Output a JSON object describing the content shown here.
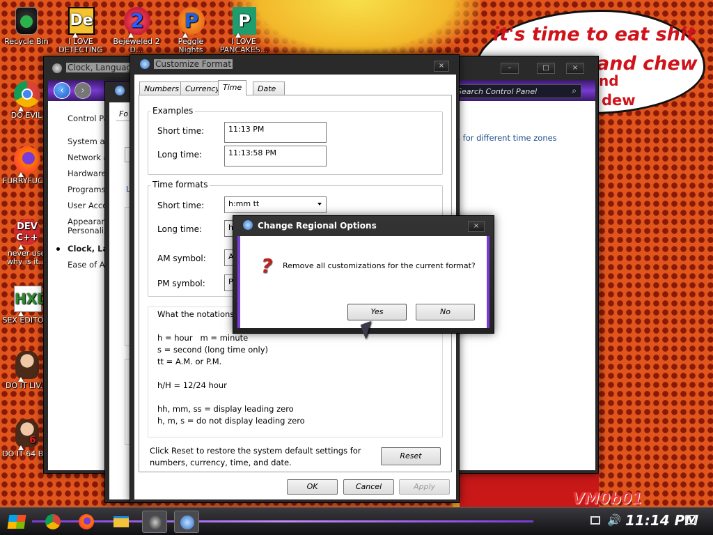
{
  "desktop": {
    "icons": [
      {
        "label": "Recycle Bin"
      },
      {
        "label": "I LOVE DETECTING"
      },
      {
        "label": "Bejeweled 2 D..."
      },
      {
        "label": "Peggle Nights"
      },
      {
        "label": "I LOVE PANCAKES..."
      },
      {
        "label": "DO EVIL"
      },
      {
        "label": "FURRYFUC..."
      },
      {
        "label": "never use why is it..."
      },
      {
        "label": "SEX EDITO..."
      },
      {
        "label": "DO IT LIV..."
      },
      {
        "label": "DO IT 64 B..."
      }
    ],
    "speech_bubble": {
      "line1": "it's time to eat shit",
      "line2": "and chew",
      "line3": "nd",
      "line4": "dew"
    },
    "watermark": "VM0b01"
  },
  "control_panel": {
    "title": "Clock, Language, and Region",
    "search_placeholder": "Search Control Panel",
    "sidebar": [
      {
        "label": "Control Pa..."
      },
      {
        "label": "System an..."
      },
      {
        "label": "Network a..."
      },
      {
        "label": "Hardware ..."
      },
      {
        "label": "Programs"
      },
      {
        "label": "User Acco..."
      },
      {
        "label": "Appearanc..."
      },
      {
        "label": "Personaliz..."
      },
      {
        "label": "Clock, Lan..."
      },
      {
        "label": "Ease of A..."
      }
    ],
    "link_text": "s for different time zones"
  },
  "region_window": {
    "tab_label": "Fo"
  },
  "customize_format": {
    "title": "Customize Format",
    "tabs": [
      "Numbers",
      "Currency",
      "Time",
      "Date"
    ],
    "active_tab": "Time",
    "examples": {
      "legend": "Examples",
      "short_label": "Short time:",
      "short_value": "11:13 PM",
      "long_label": "Long time:",
      "long_value": "11:13:58 PM"
    },
    "formats": {
      "legend": "Time formats",
      "short_label": "Short time:",
      "short_value": "h:mm tt",
      "long_label": "Long time:",
      "long_value": "h",
      "am_label": "AM symbol:",
      "am_value": "A",
      "pm_label": "PM symbol:",
      "pm_value": "P"
    },
    "notation": {
      "heading": "What the notations",
      "line1": "h = hour   m = minute",
      "line2": "s = second (long time only)",
      "line3": "tt = A.M. or P.M.",
      "line4": "h/H = 12/24 hour",
      "line5": "hh, mm, ss = display leading zero",
      "line6": "h, m, s = do not display leading zero"
    },
    "reset_note": "Click Reset to restore the system default settings for numbers, currency, time, and date.",
    "reset_label": "Reset",
    "ok_label": "OK",
    "cancel_label": "Cancel",
    "apply_label": "Apply"
  },
  "dialog": {
    "title": "Change Regional Options",
    "message": "Remove all customizations for the current format?",
    "yes_label": "Yes",
    "no_label": "No",
    "close_label": "×"
  },
  "taskbar": {
    "clock": "11:14 PM"
  },
  "colors": {
    "accent": "#7a3bd6",
    "desktop_orange": "#e0551c"
  }
}
